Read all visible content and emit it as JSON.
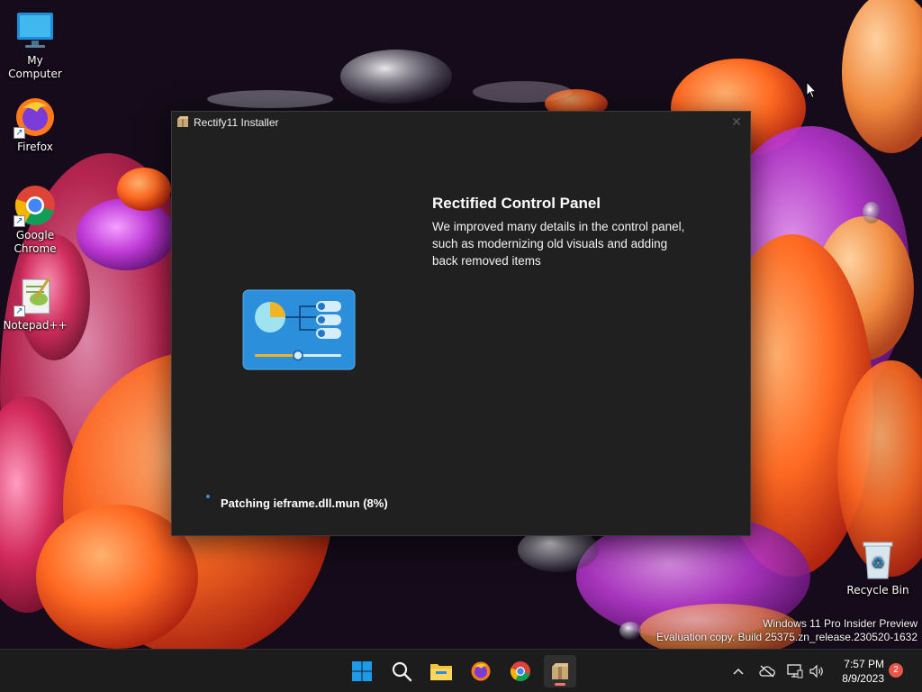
{
  "desktop": {
    "icons": [
      {
        "label": "My Computer",
        "icon": "computer-icon"
      },
      {
        "label": "Firefox",
        "icon": "firefox-icon"
      },
      {
        "label": "Google Chrome",
        "icon": "chrome-icon"
      },
      {
        "label": "Notepad++",
        "icon": "notepad-plus-plus-icon"
      },
      {
        "label": "Recycle Bin",
        "icon": "recycle-bin-icon"
      }
    ]
  },
  "window": {
    "title": "Rectify11 Installer",
    "close_glyph": "✕",
    "feature_title": "Rectified Control Panel",
    "feature_description": "We improved many details in the control panel, such as modernizing old visuals and adding back removed items",
    "status": "Patching ieframe.dll.mun (8%)",
    "progress_percent": 8
  },
  "watermark": {
    "line1": "Windows 11 Pro Insider Preview",
    "line2": "Evaluation copy. Build 25375.zn_release.230520-1632"
  },
  "taskbar": {
    "apps": [
      "start-icon",
      "search-icon",
      "file-explorer-icon",
      "firefox-icon",
      "chrome-icon",
      "rectify11-installer-icon"
    ],
    "tray_icons": [
      "chevron-up-icon",
      "onedrive-offline-icon",
      "network-icon",
      "volume-icon"
    ],
    "time": "7:57 PM",
    "date": "8/9/2023",
    "notification_count": "2"
  },
  "colors": {
    "window_bg": "#202020",
    "taskbar_bg": "#1c1c1c",
    "accent": "#3a8ee6",
    "badge": "#e8554a"
  }
}
